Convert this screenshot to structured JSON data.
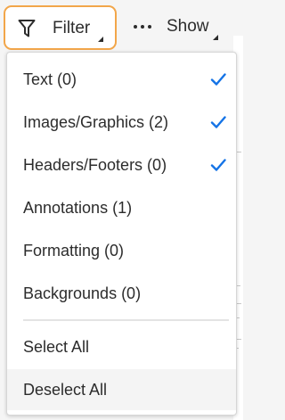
{
  "toolbar": {
    "filter_button": {
      "label": "Filter",
      "icon": "filter-funnel-icon",
      "focus_color": "#f2a64a"
    },
    "show_button": {
      "label": "Show",
      "icon": "more-horizontal-icon"
    }
  },
  "menu": {
    "items": [
      {
        "label": "Text (0)",
        "checked": true
      },
      {
        "label": "Images/Graphics (2)",
        "checked": true
      },
      {
        "label": "Headers/Footers (0)",
        "checked": true
      },
      {
        "label": "Annotations (1)",
        "checked": false
      },
      {
        "label": "Formatting (0)",
        "checked": false
      },
      {
        "label": "Backgrounds (0)",
        "checked": false
      }
    ],
    "actions": [
      {
        "label": "Select All"
      },
      {
        "label": "Deselect All",
        "hovered": true
      }
    ],
    "check_color": "#1473e6"
  }
}
